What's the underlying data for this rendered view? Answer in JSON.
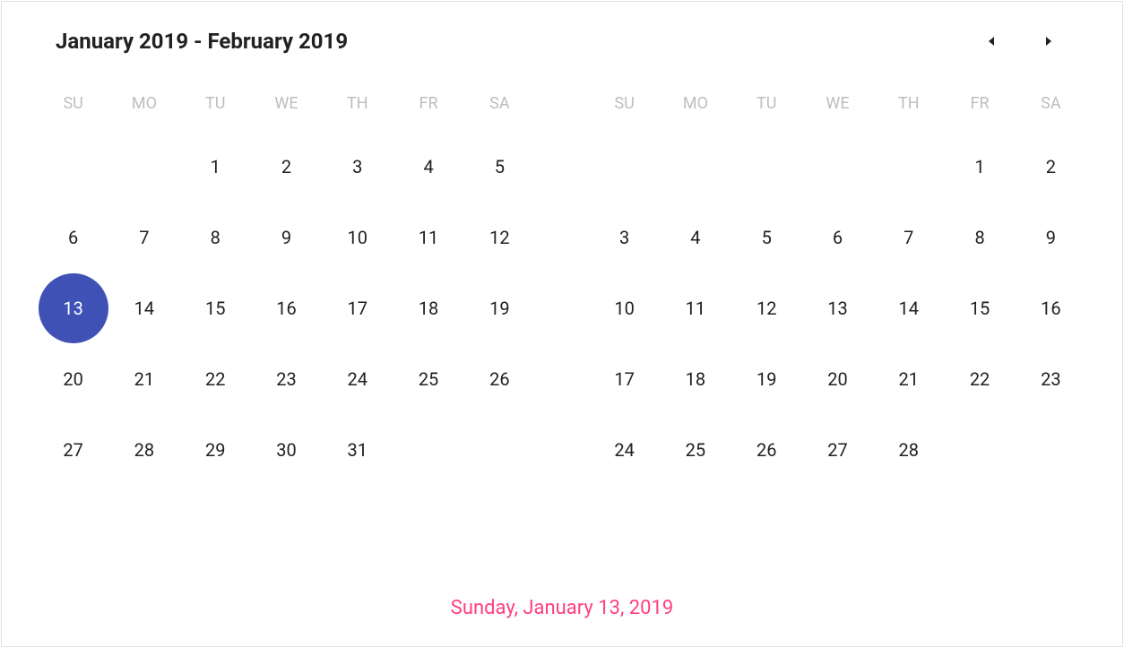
{
  "header": {
    "title": "January 2019 - February 2019"
  },
  "weekdays": [
    "SU",
    "MO",
    "TU",
    "WE",
    "TH",
    "FR",
    "SA"
  ],
  "months": [
    {
      "name": "january",
      "startOffset": 2,
      "daysCount": 31,
      "selectedDay": 13
    },
    {
      "name": "february",
      "startOffset": 5,
      "daysCount": 28,
      "selectedDay": null
    }
  ],
  "footer": {
    "selectedDateText": "Sunday, January 13, 2019"
  },
  "colors": {
    "selected": "#3f51b5",
    "accent": "#ff4081"
  }
}
